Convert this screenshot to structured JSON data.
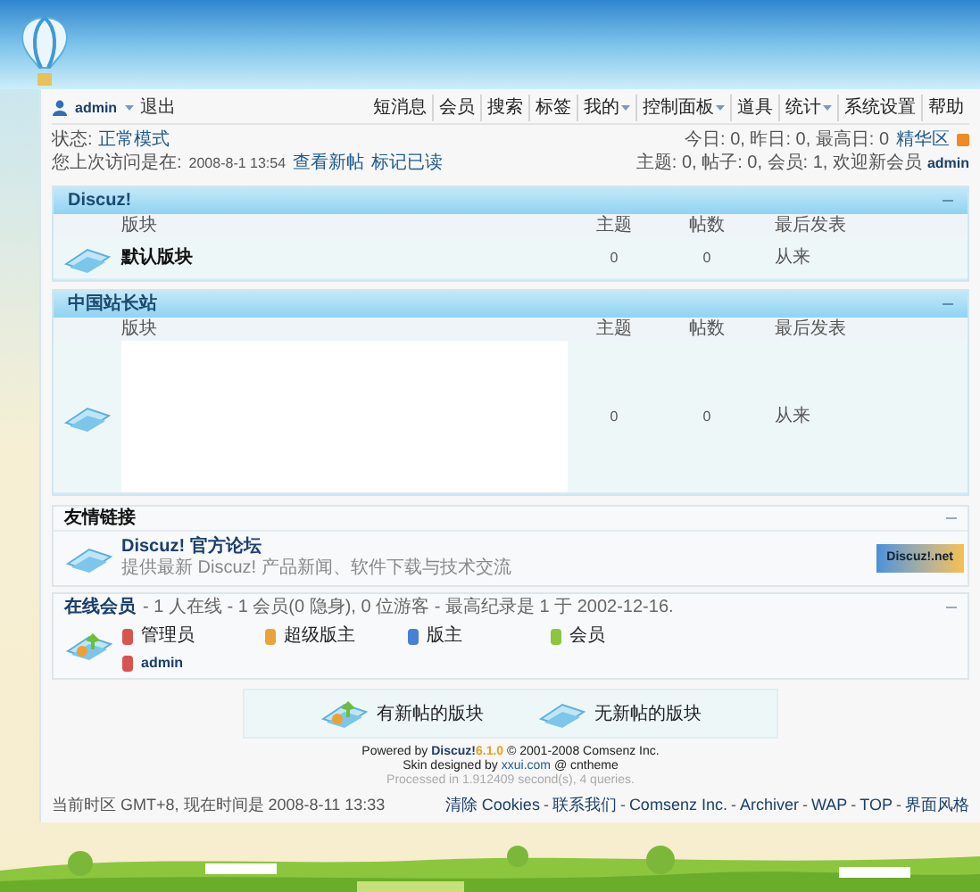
{
  "user_bar": {
    "username": "admin",
    "logout": "退出"
  },
  "nav": [
    {
      "label": "短消息",
      "has_menu": false
    },
    {
      "label": "会员",
      "has_menu": false
    },
    {
      "label": "搜索",
      "has_menu": false
    },
    {
      "label": "标签",
      "has_menu": false
    },
    {
      "label": "我的",
      "has_menu": true
    },
    {
      "label": "控制面板",
      "has_menu": true
    },
    {
      "label": "道具",
      "has_menu": false
    },
    {
      "label": "统计",
      "has_menu": true
    },
    {
      "label": "系统设置",
      "has_menu": false
    },
    {
      "label": "帮助",
      "has_menu": false
    }
  ],
  "status": {
    "mode_label": "状态:",
    "mode": "正常模式",
    "last_visit_label": "您上次访问是在:",
    "last_visit": "2008-8-1 13:54",
    "view_new": "查看新帖",
    "mark_read": "标记已读",
    "today": "今日: 0, 昨日: 0, 最高日: 0",
    "digest": "精华区",
    "stats": "主题: 0, 帖子: 0, 会员: 1, 欢迎新会员",
    "new_member": "admin"
  },
  "categories": [
    {
      "title": "Discuz!",
      "columns": [
        "版块",
        "主题",
        "帖数",
        "最后发表"
      ],
      "forums": [
        {
          "name": "默认版块",
          "threads": "0",
          "posts": "0",
          "last_post": "从来",
          "tall": false
        }
      ]
    },
    {
      "title": "中国站长站",
      "columns": [
        "版块",
        "主题",
        "帖数",
        "最后发表"
      ],
      "forums": [
        {
          "threads": "0",
          "posts": "0",
          "last_post": "从来",
          "tall": true
        }
      ]
    }
  ],
  "friend_links": {
    "title": "友情链接",
    "items": [
      {
        "name": "Discuz! 官方论坛",
        "description": "提供最新 Discuz! 产品新闻、软件下载与技术交流",
        "logo": "Discuz!.net"
      }
    ]
  },
  "online": {
    "title": "在线会员",
    "summary": "- 1 人在线 - 1 会员(0 隐身), 0 位游客 - 最高纪录是 1 于 2002-12-16.",
    "legend": [
      {
        "label": "管理员",
        "color": "#d9534f"
      },
      {
        "label": "超级版主",
        "color": "#e8a33a"
      },
      {
        "label": "版主",
        "color": "#4a7fd6"
      },
      {
        "label": "会员",
        "color": "#8cc63f"
      }
    ],
    "members": [
      {
        "name": "admin",
        "color": "#d9534f"
      }
    ]
  },
  "legend": [
    {
      "label": "有新帖的版块",
      "has_new": true
    },
    {
      "label": "无新帖的版块",
      "has_new": false
    }
  ],
  "powered": {
    "prefix": "Powered by",
    "brand": "Discuz!",
    "version": "6.1.0",
    "suffix": "© 2001-2008 Comsenz Inc.",
    "skin_prefix": "Skin designed by",
    "skin_site": "xxui.com",
    "skin_suffix": "@ cntheme",
    "processed": "Processed in 1.912409 second(s), 4 queries."
  },
  "footer": {
    "timezone": "当前时区 GMT+8, 现在时间是 2008-8-11 13:33",
    "separator": "-",
    "links": [
      "清除 Cookies",
      "联系我们",
      "Comsenz Inc.",
      "Archiver",
      "WAP",
      "TOP",
      "界面风格"
    ]
  }
}
